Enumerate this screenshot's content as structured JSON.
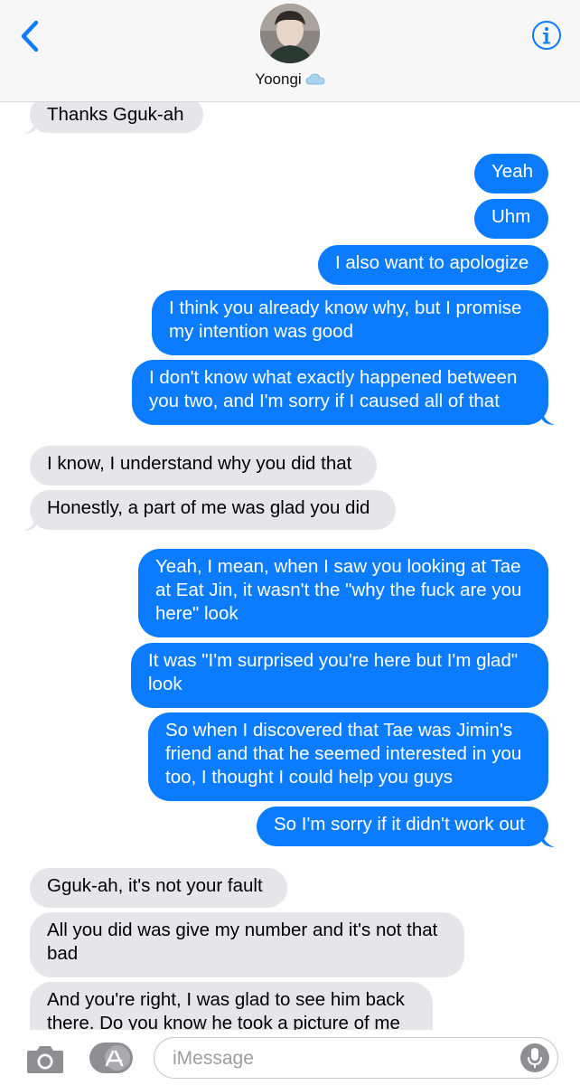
{
  "header": {
    "contact_name": "Yoongi",
    "contact_emoji_icon": "cloud-icon",
    "back_icon": "chevron-left-icon",
    "info_icon": "info-icon",
    "accent_color": "#0b7bff"
  },
  "messages": [
    {
      "from": "contact",
      "text": "Thanks Gguk-ah"
    },
    {
      "from": "me",
      "text": "Yeah"
    },
    {
      "from": "me",
      "text": "Uhm"
    },
    {
      "from": "me",
      "text": "I also want to apologize"
    },
    {
      "from": "me",
      "text": "I think you already know why, but I promise my intention was good"
    },
    {
      "from": "me",
      "text": "I don't know what exactly happened between you two, and I'm sorry if I caused all of that"
    },
    {
      "from": "contact",
      "text": "I know, I understand why you did that"
    },
    {
      "from": "contact",
      "text": "Honestly, a part of me was glad you did"
    },
    {
      "from": "me",
      "text": "Yeah, I mean, when I saw you looking at Tae at Eat Jin, it wasn't the \"why the fuck are you here\" look"
    },
    {
      "from": "me",
      "text": "It was \"I'm surprised you're here but I'm glad\" look"
    },
    {
      "from": "me",
      "text": "So when I discovered that Tae was Jimin's friend and that he seemed interested in you too, I thought I could help you guys"
    },
    {
      "from": "me",
      "text": "So I'm sorry if it didn't work out"
    },
    {
      "from": "contact",
      "text": "Gguk-ah, it's not your fault"
    },
    {
      "from": "contact",
      "text": "All you did was give my number and it's not that bad"
    },
    {
      "from": "contact",
      "text": "And you're right, I was glad to see him back there. Do you know he took a picture of me"
    }
  ],
  "composer": {
    "placeholder": "iMessage",
    "value": "",
    "camera_icon": "camera-icon",
    "apps_icon": "app-store-icon",
    "mic_icon": "microphone-icon"
  },
  "colors": {
    "sent_bubble": "#0b7bff",
    "received_bubble": "#e5e5ea"
  }
}
